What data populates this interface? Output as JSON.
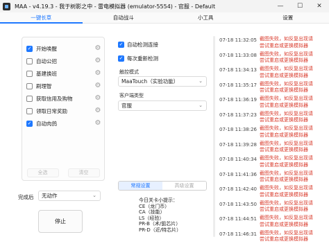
{
  "window": {
    "title": "MAA - v4.19.3 - 我于树影之中 - 雷电模拟器 (emulator-5554) - 官服 - Default",
    "controls": [
      "—",
      "☐",
      "✕"
    ]
  },
  "tabs": [
    {
      "label": "一键长草",
      "active": true
    },
    {
      "label": "自动战斗",
      "active": false
    },
    {
      "label": "小工具",
      "active": false
    },
    {
      "label": "设置",
      "active": false
    }
  ],
  "tasks": [
    {
      "label": "开始唤醒",
      "checked": true
    },
    {
      "label": "自动公招",
      "checked": false
    },
    {
      "label": "基建换班",
      "checked": false
    },
    {
      "label": "刷理智",
      "checked": false
    },
    {
      "label": "获取信用及购物",
      "checked": false
    },
    {
      "label": "领取日常奖励",
      "checked": false
    },
    {
      "label": "自动肉鸽",
      "checked": true
    }
  ],
  "task_panel": {
    "select_all": "全选",
    "clear": "清空"
  },
  "after_finish": {
    "label": "完成后",
    "value": "无动作"
  },
  "stop_button": "停止",
  "settings": {
    "auto_detect_connection": {
      "label": "自动检测连接",
      "checked": true
    },
    "redetect_each_time": {
      "label": "每次重新检测",
      "checked": true
    },
    "touch_mode_label": "触控模式",
    "touch_mode_value": "MaaTouch（实验功能）",
    "client_type_label": "客户端类型",
    "client_type_value": "官服",
    "seg_normal": "常规设置",
    "seg_advanced": "高级设置"
  },
  "tips": [
    "今日关卡小提示：",
    "CE（龙门币）",
    "CA（技能）",
    "LS（经验）",
    "PR-B（术/狙芯片）",
    "PR-D（近/特芯片）"
  ],
  "logs": [
    {
      "time": "07-18  11:32:05",
      "lines": [
        "截图失败，如反复出现请",
        "尝试重启或更换模拟器"
      ]
    },
    {
      "time": "07-18  11:33:08",
      "lines": [
        "截图失败，如反复出现请",
        "尝试重启或更换模拟器"
      ]
    },
    {
      "time": "07-18  11:34:13",
      "lines": [
        "截图失败，如反复出现请",
        "尝试重启或更换模拟器"
      ]
    },
    {
      "time": "07-18  11:35:17",
      "lines": [
        "截图失败，如反复出现请",
        "尝试重启或更换模拟器"
      ]
    },
    {
      "time": "07-18  11:36:19",
      "lines": [
        "截图失败，如反复出现请",
        "尝试重启或更换模拟器"
      ]
    },
    {
      "time": "07-18  11:37:23",
      "lines": [
        "截图失败，如反复出现请",
        "尝试重启或更换模拟器"
      ]
    },
    {
      "time": "07-18  11:38:26",
      "lines": [
        "截图失败，如反复出现请",
        "尝试重启或更换模拟器"
      ]
    },
    {
      "time": "07-18  11:39:28",
      "lines": [
        "截图失败，如反复出现请",
        "尝试重启或更换模拟器"
      ]
    },
    {
      "time": "07-18  11:40:34",
      "lines": [
        "截图失败，如反复出现请",
        "尝试重启或更换模拟器"
      ]
    },
    {
      "time": "07-18  11:41:36",
      "lines": [
        "截图失败，如反复出现请",
        "尝试重启或更换模拟器"
      ]
    },
    {
      "time": "07-18  11:42:40",
      "lines": [
        "截图失败，如反复出现请",
        "尝试重启或更换模拟器"
      ]
    },
    {
      "time": "07-18  11:43:50",
      "lines": [
        "截图失败，如反复出现请",
        "尝试重启或更换模拟器"
      ]
    },
    {
      "time": "07-18  11:44:51",
      "lines": [
        "截图失败，如反复出现请",
        "尝试重启或更换模拟器"
      ]
    },
    {
      "time": "07-18  11:46:31",
      "lines": [
        "截图失败，如反复出现请",
        "尝试重启或更换模拟器"
      ]
    }
  ]
}
